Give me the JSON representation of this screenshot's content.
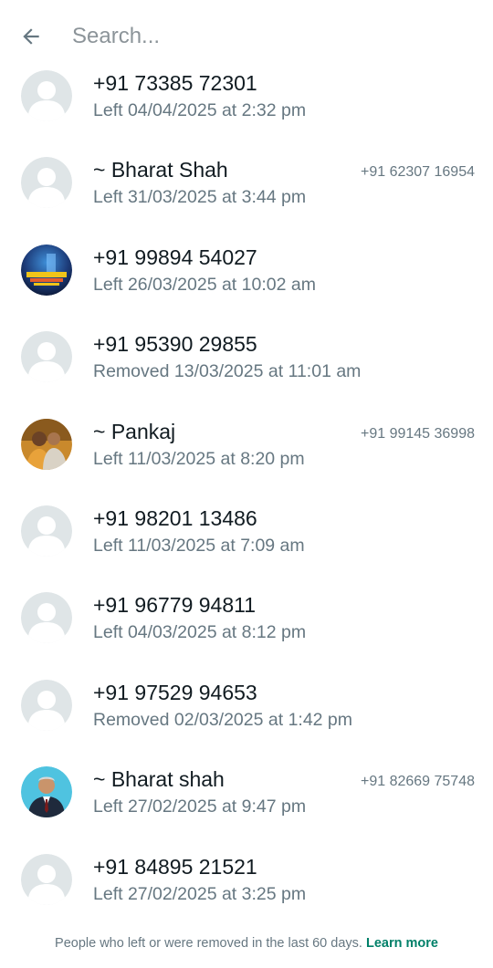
{
  "header": {
    "search_placeholder": "Search..."
  },
  "members": [
    {
      "name": "+91 73385 72301",
      "status": "Left 04/04/2025 at 2:32 pm",
      "phone": "",
      "avatar": "default-avatar-icon"
    },
    {
      "name": "~ Bharat Shah",
      "status": "Left 31/03/2025 at 3:44 pm",
      "phone": "+91 62307 16954",
      "avatar": "default-avatar-icon"
    },
    {
      "name": "+91 99894 54027",
      "status": "Left 26/03/2025 at 10:02 am",
      "phone": "",
      "avatar": "profile-photo"
    },
    {
      "name": "+91 95390 29855",
      "status": "Removed 13/03/2025 at 11:01 am",
      "phone": "",
      "avatar": "default-avatar-icon"
    },
    {
      "name": "~ Pankaj",
      "status": "Left 11/03/2025 at 8:20 pm",
      "phone": "+91 99145 36998",
      "avatar": "profile-photo"
    },
    {
      "name": "+91 98201 13486",
      "status": "Left 11/03/2025 at 7:09 am",
      "phone": "",
      "avatar": "default-avatar-icon"
    },
    {
      "name": "+91 96779 94811",
      "status": "Left 04/03/2025 at 8:12 pm",
      "phone": "",
      "avatar": "default-avatar-icon"
    },
    {
      "name": "+91 97529 94653",
      "status": "Removed 02/03/2025 at 1:42 pm",
      "phone": "",
      "avatar": "default-avatar-icon"
    },
    {
      "name": "~ Bharat shah",
      "status": "Left 27/02/2025 at 9:47 pm",
      "phone": "+91 82669 75748",
      "avatar": "profile-photo"
    },
    {
      "name": "+91 84895 21521",
      "status": "Left 27/02/2025 at 3:25 pm",
      "phone": "",
      "avatar": "default-avatar-icon"
    }
  ],
  "footer": {
    "note": "People who left or were removed in the last 60 days.",
    "link": "Learn more"
  },
  "colors": {
    "accent": "#008069",
    "secondary_text": "#667781",
    "avatar_bg": "#dfe5e7"
  }
}
